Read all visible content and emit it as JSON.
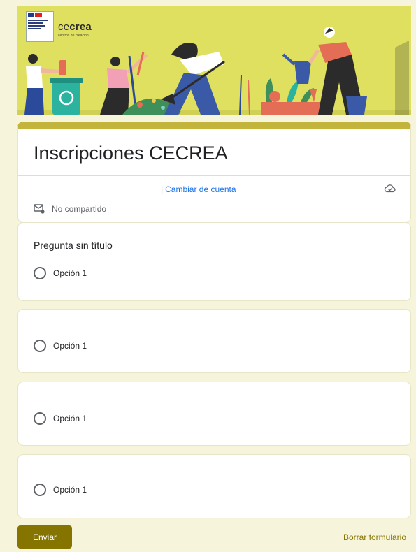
{
  "banner": {
    "brand_ce": "ce",
    "brand_crea": "crea",
    "brand_sub": "centros de creación"
  },
  "form": {
    "title": "Inscripciones CECREA",
    "account_sep": "|",
    "switch_account": "Cambiar de cuenta",
    "not_shared": "No compartido"
  },
  "questions": [
    {
      "title": "Pregunta sin título",
      "option": "Opción 1"
    },
    {
      "title": "",
      "option": "Opción 1"
    },
    {
      "title": "",
      "option": "Opción 1"
    },
    {
      "title": "",
      "option": "Opción 1"
    }
  ],
  "footer": {
    "submit": "Enviar",
    "clear": "Borrar formulario"
  },
  "colors": {
    "accent": "#857500",
    "banner_bg": "#dfe05f",
    "page_bg": "#f6f5dc",
    "link": "#1a73e8"
  }
}
